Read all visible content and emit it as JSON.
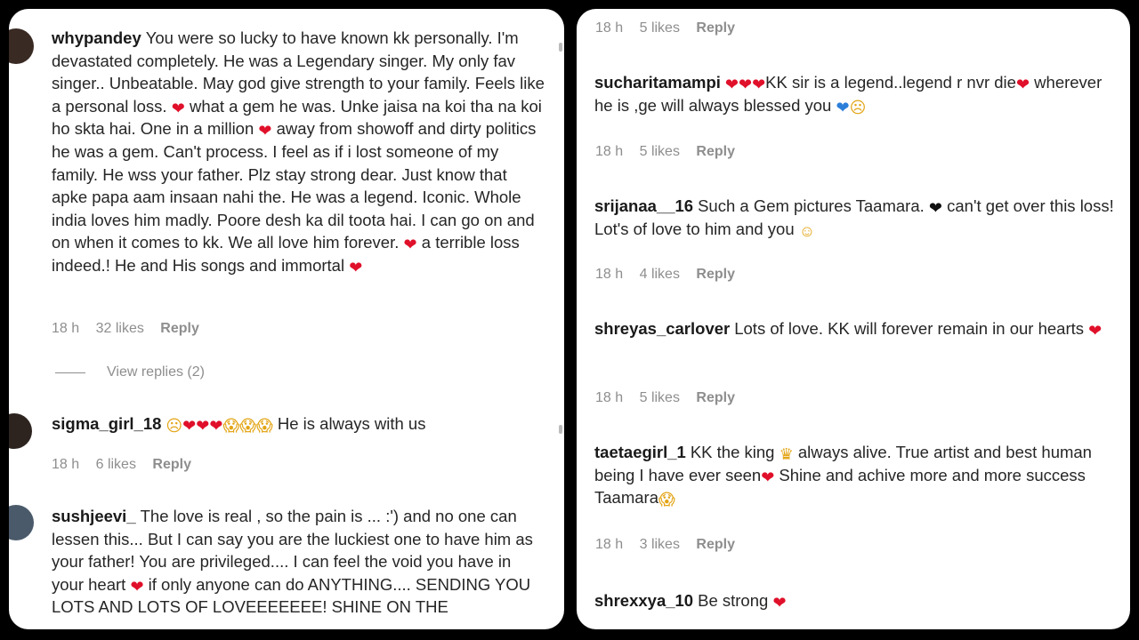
{
  "left": {
    "comments": [
      {
        "user": "whypandey",
        "segments": [
          {
            "t": "You were so lucky to have known kk personally. I'm devastated completely. He was a Legendary singer. My only fav singer.. Unbeatable. May god give strength to your family. Feels like a personal loss. "
          },
          {
            "e": "broken-heart-icon"
          },
          {
            "t": " what a gem he was. Unke jaisa na koi tha na koi ho skta hai. One in a million "
          },
          {
            "e": "heart-icon"
          },
          {
            "t": " away from showoff and dirty politics he was a gem. Can't process. I feel as if i lost someone of my family. He wss your father. Plz stay strong dear. Just know that apke papa aam insaan nahi the. He was a legend. Iconic. Whole india loves him madly. Poore desh ka dil toota hai. I can go on and on when it comes to kk. We all love him forever. "
          },
          {
            "e": "heart-icon"
          },
          {
            "t": " a terrible loss indeed.! He and His songs and immortal "
          },
          {
            "e": "heart-icon"
          }
        ],
        "time": "18 h",
        "likes": "32 likes",
        "reply": "Reply"
      },
      {
        "user": "sigma_girl_18",
        "segments": [
          {
            "e": "sad-face-icon"
          },
          {
            "e": "heart-icon"
          },
          {
            "e": "heart-icon"
          },
          {
            "e": "heart-icon"
          },
          {
            "e": "screaming-face-icon"
          },
          {
            "e": "screaming-face-icon"
          },
          {
            "e": "screaming-face-icon"
          },
          {
            "t": " He is always with us"
          }
        ],
        "time": "18 h",
        "likes": "6 likes",
        "reply": "Reply"
      },
      {
        "user": "sushjeevi_",
        "segments": [
          {
            "t": "The love is real , so the pain is ... :') and no one can lessen this... But I can say you are the luckiest one to have him as your father! You are privileged.... I can feel the void you have in your heart "
          },
          {
            "e": "broken-heart-icon"
          },
          {
            "t": " if only anyone can do ANYTHING.... SENDING YOU LOTS AND LOTS OF LOVEEEEEEE! SHINE ON THE"
          }
        ]
      }
    ],
    "view_replies": "View replies (2)"
  },
  "right": {
    "top_meta": {
      "time": "18 h",
      "likes": "5 likes",
      "reply": "Reply"
    },
    "comments": [
      {
        "user": "sucharitamampi",
        "segments": [
          {
            "e": "heart-icon"
          },
          {
            "e": "heart-icon"
          },
          {
            "e": "heart-icon"
          },
          {
            "t": "KK sir is a legend..legend r nvr die"
          },
          {
            "e": "heart-icon"
          },
          {
            "t": " wherever he is ,ge will always blessed you "
          },
          {
            "e": "blue-heart-icon"
          },
          {
            "e": "disappointed-face-icon"
          }
        ],
        "time": "18 h",
        "likes": "5 likes",
        "reply": "Reply"
      },
      {
        "user": "srijanaa__16",
        "segments": [
          {
            "t": "Such a Gem pictures Taamara. "
          },
          {
            "e": "black-heart-icon"
          },
          {
            "t": " can't get over this loss! Lot's of love to him and you "
          },
          {
            "e": "smile-face-icon"
          }
        ],
        "time": "18 h",
        "likes": "4 likes",
        "reply": "Reply"
      },
      {
        "user": "shreyas_carlover",
        "segments": [
          {
            "t": "Lots of love. KK will forever remain in our hearts "
          },
          {
            "e": "heart-icon"
          }
        ],
        "time": "18 h",
        "likes": "5 likes",
        "reply": "Reply"
      },
      {
        "user": "taetaegirl_1",
        "segments": [
          {
            "t": "KK the king "
          },
          {
            "e": "crown-icon"
          },
          {
            "t": " always alive. True artist and best human being I have ever seen"
          },
          {
            "e": "heart-icon"
          },
          {
            "t": " Shine and achive more and more success Taamara"
          },
          {
            "e": "screaming-face-icon"
          }
        ],
        "time": "18 h",
        "likes": "3 likes",
        "reply": "Reply"
      },
      {
        "user": "shrexxya_10",
        "segments": [
          {
            "t": "Be strong "
          },
          {
            "e": "heart-icon"
          }
        ]
      }
    ]
  },
  "emoji_glyphs": {
    "heart-icon": "❤",
    "broken-heart-icon": "❤",
    "blue-heart-icon": "❤",
    "black-heart-icon": "❤",
    "sad-face-icon": "☹",
    "screaming-face-icon": "😱",
    "disappointed-face-icon": "☹",
    "smile-face-icon": "☺",
    "crown-icon": "♛"
  },
  "colors": {
    "username": "#1a1a1a",
    "text": "#262626",
    "meta": "#8e8e8e",
    "heart": "#e0102a",
    "blue_heart": "#2b7fd9",
    "face": "#e3a414"
  }
}
